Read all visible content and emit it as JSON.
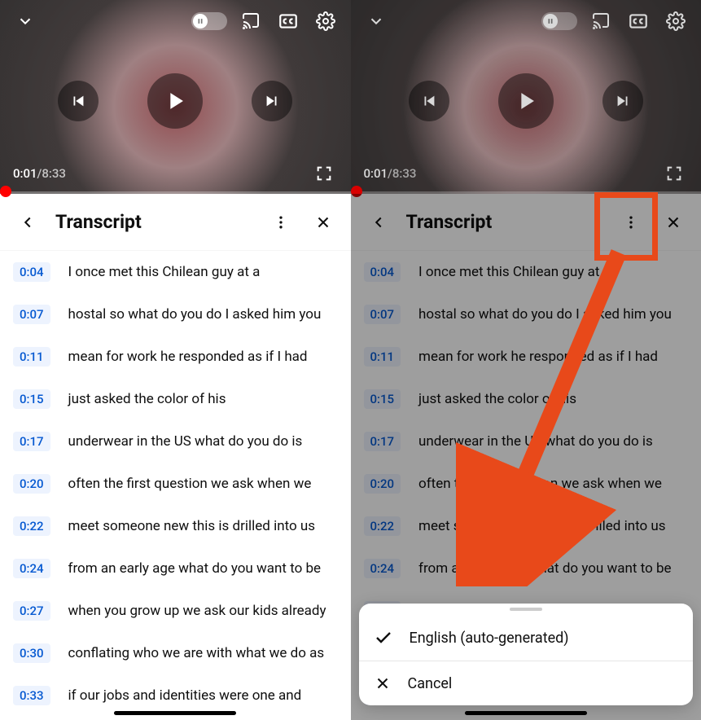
{
  "video": {
    "current_time": "0:01",
    "duration": "8:33",
    "separator": " / "
  },
  "transcript": {
    "title": "Transcript",
    "lines": [
      {
        "time": "0:04",
        "text": "I once met this Chilean guy at a"
      },
      {
        "time": "0:07",
        "text": "hostal so what do you do I asked him you"
      },
      {
        "time": "0:11",
        "text": "mean for work he responded as if I had"
      },
      {
        "time": "0:15",
        "text": "just asked the color of his"
      },
      {
        "time": "0:17",
        "text": "underwear in the US what do you do is"
      },
      {
        "time": "0:20",
        "text": "often the first question we ask when we"
      },
      {
        "time": "0:22",
        "text": "meet someone new this is drilled into us"
      },
      {
        "time": "0:24",
        "text": "from an early age what do you want to be"
      },
      {
        "time": "0:27",
        "text": "when you grow up we ask our kids already"
      },
      {
        "time": "0:30",
        "text": "conflating who we are with what we do as"
      },
      {
        "time": "0:33",
        "text": "if our jobs and identities were one and"
      }
    ]
  },
  "sheet": {
    "option": "English (auto-generated)",
    "cancel": "Cancel"
  }
}
